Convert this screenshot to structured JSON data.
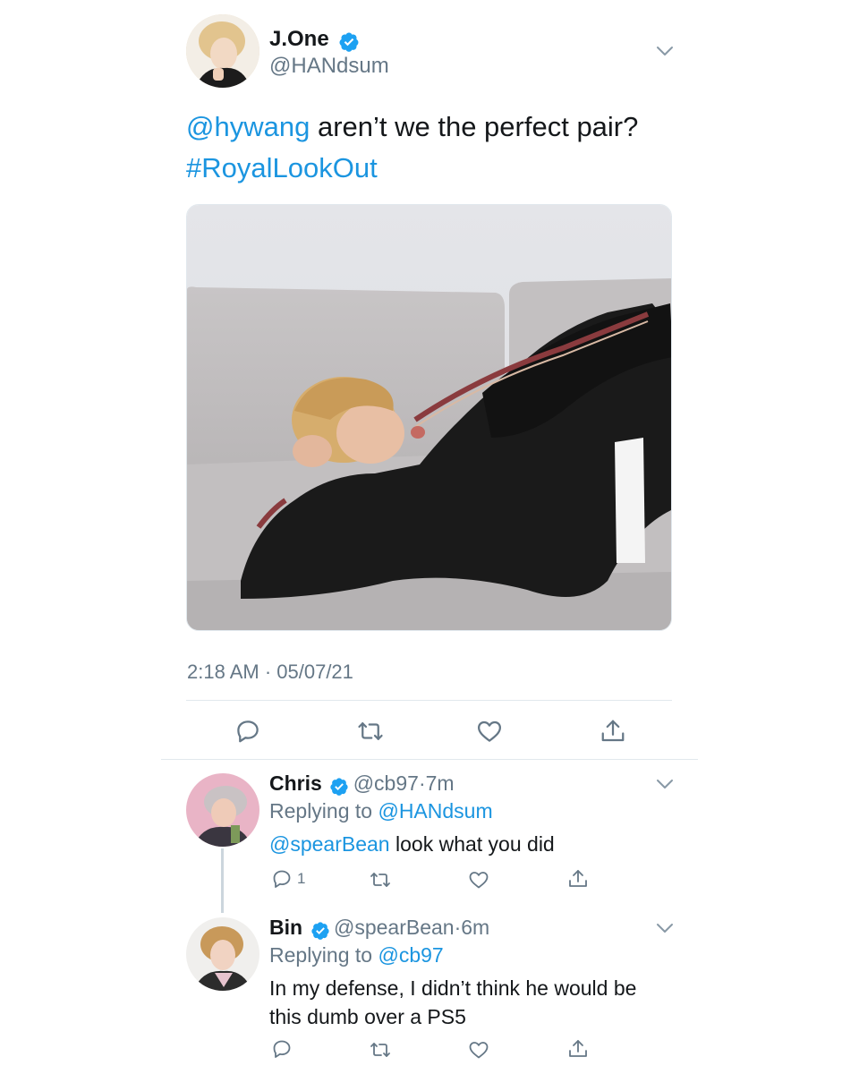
{
  "main_tweet": {
    "display_name": "J.One",
    "handle": "@HANdsum",
    "mention": "@hywang",
    "text": "aren’t we the perfect pair?",
    "hashtag": "#RoyalLookOut",
    "timestamp": "2:18 AM · 05/07/21"
  },
  "replies": [
    {
      "display_name": "Chris",
      "handle": "@cb97",
      "time": "·7m",
      "replying_label": "Replying to",
      "replying_to": "@HANdsum",
      "mention": "@spearBean",
      "text": "look what you did",
      "reply_count": "1"
    },
    {
      "display_name": "Bin",
      "handle": "@spearBean",
      "time": "·6m",
      "replying_label": "Replying to",
      "replying_to": "@cb97",
      "text_line1": "In my defense, I didn’t think he would be",
      "text_line2": "this dumb over a PS5"
    }
  ],
  "colors": {
    "link": "#1b95e0",
    "muted": "#657786",
    "verified": "#1da1f2"
  },
  "icons": [
    "verified-badge-icon",
    "chevron-down-icon",
    "reply-icon",
    "retweet-icon",
    "like-icon",
    "share-icon"
  ]
}
